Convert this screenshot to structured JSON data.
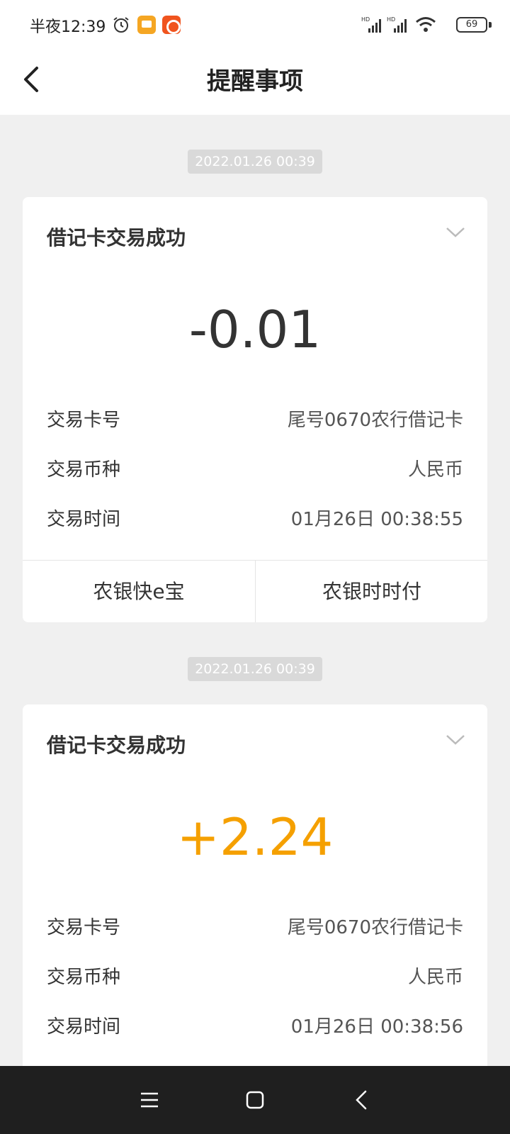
{
  "status_bar": {
    "time": "半夜12:39",
    "battery": "69",
    "icons": [
      "alarm-icon",
      "messages-app-icon",
      "kuaishou-app-icon",
      "hd-signal-icon",
      "hd-signal-icon",
      "wifi-icon",
      "battery-icon"
    ]
  },
  "header": {
    "title": "提醒事项",
    "back_icon": "back-arrow-icon"
  },
  "messages": [
    {
      "timestamp": "2022.01.26 00:39",
      "title": "借记卡交易成功",
      "amount": "-0.01",
      "amount_color": "#333333",
      "rows": [
        {
          "label": "交易卡号",
          "value": "尾号0670农行借记卡"
        },
        {
          "label": "交易币种",
          "value": "人民币"
        },
        {
          "label": "交易时间",
          "value": "01月26日 00:38:55"
        }
      ],
      "actions": [
        "农银快e宝",
        "农银时时付"
      ]
    },
    {
      "timestamp": "2022.01.26 00:39",
      "title": "借记卡交易成功",
      "amount": "+2.24",
      "amount_color": "#f5a000",
      "rows": [
        {
          "label": "交易卡号",
          "value": "尾号0670农行借记卡"
        },
        {
          "label": "交易币种",
          "value": "人民币"
        },
        {
          "label": "交易时间",
          "value": "01月26日 00:38:56"
        }
      ]
    }
  ],
  "system_nav": [
    "menu-icon",
    "home-icon",
    "back-icon"
  ],
  "colors": {
    "background": "#f0f0f0",
    "card": "#ffffff",
    "positive_amount": "#f5a000",
    "negative_amount": "#333333",
    "system_nav": "#1f1f1f"
  }
}
